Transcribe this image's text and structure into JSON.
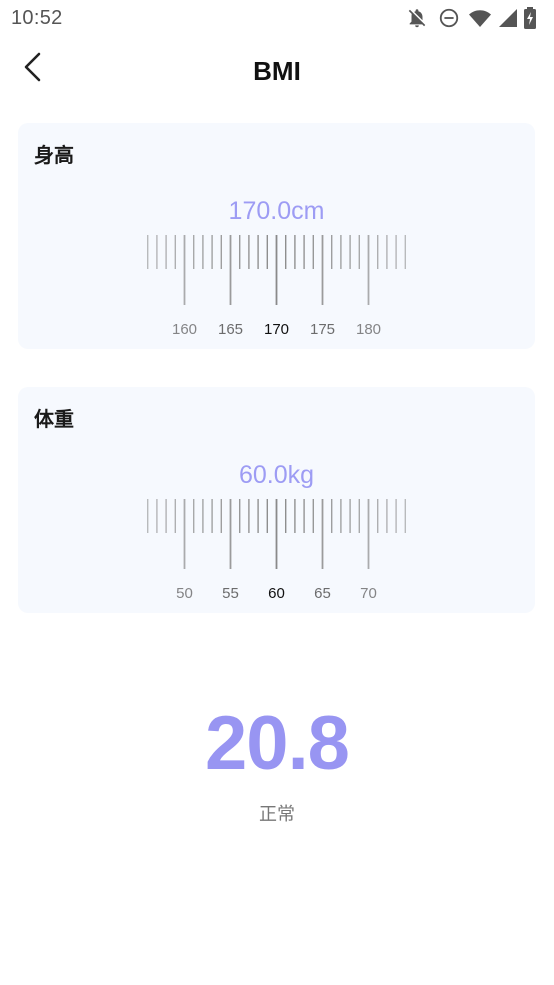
{
  "status_bar": {
    "time": "10:52",
    "icons": [
      "notifications-off-icon",
      "do-not-disturb-icon",
      "wifi-icon",
      "signal-icon",
      "battery-charging-icon"
    ]
  },
  "nav": {
    "title": "BMI",
    "back_icon": "chevron-left-icon"
  },
  "height_card": {
    "title": "身高",
    "value_display": "170.0cm",
    "value": 170.0,
    "unit": "cm",
    "min_visible": 158,
    "max_visible": 182,
    "labels": [
      "160",
      "165",
      "170",
      "175",
      "180"
    ]
  },
  "weight_card": {
    "title": "体重",
    "value_display": "60.0kg",
    "value": 60.0,
    "unit": "kg",
    "min_visible": 48,
    "max_visible": 72,
    "labels": [
      "50",
      "55",
      "60",
      "65",
      "70"
    ]
  },
  "result": {
    "bmi": "20.8",
    "status": "正常"
  },
  "colors": {
    "accent": "#9895f2",
    "card_bg": "#f6f9fe",
    "tick": "#8a8a8a"
  }
}
